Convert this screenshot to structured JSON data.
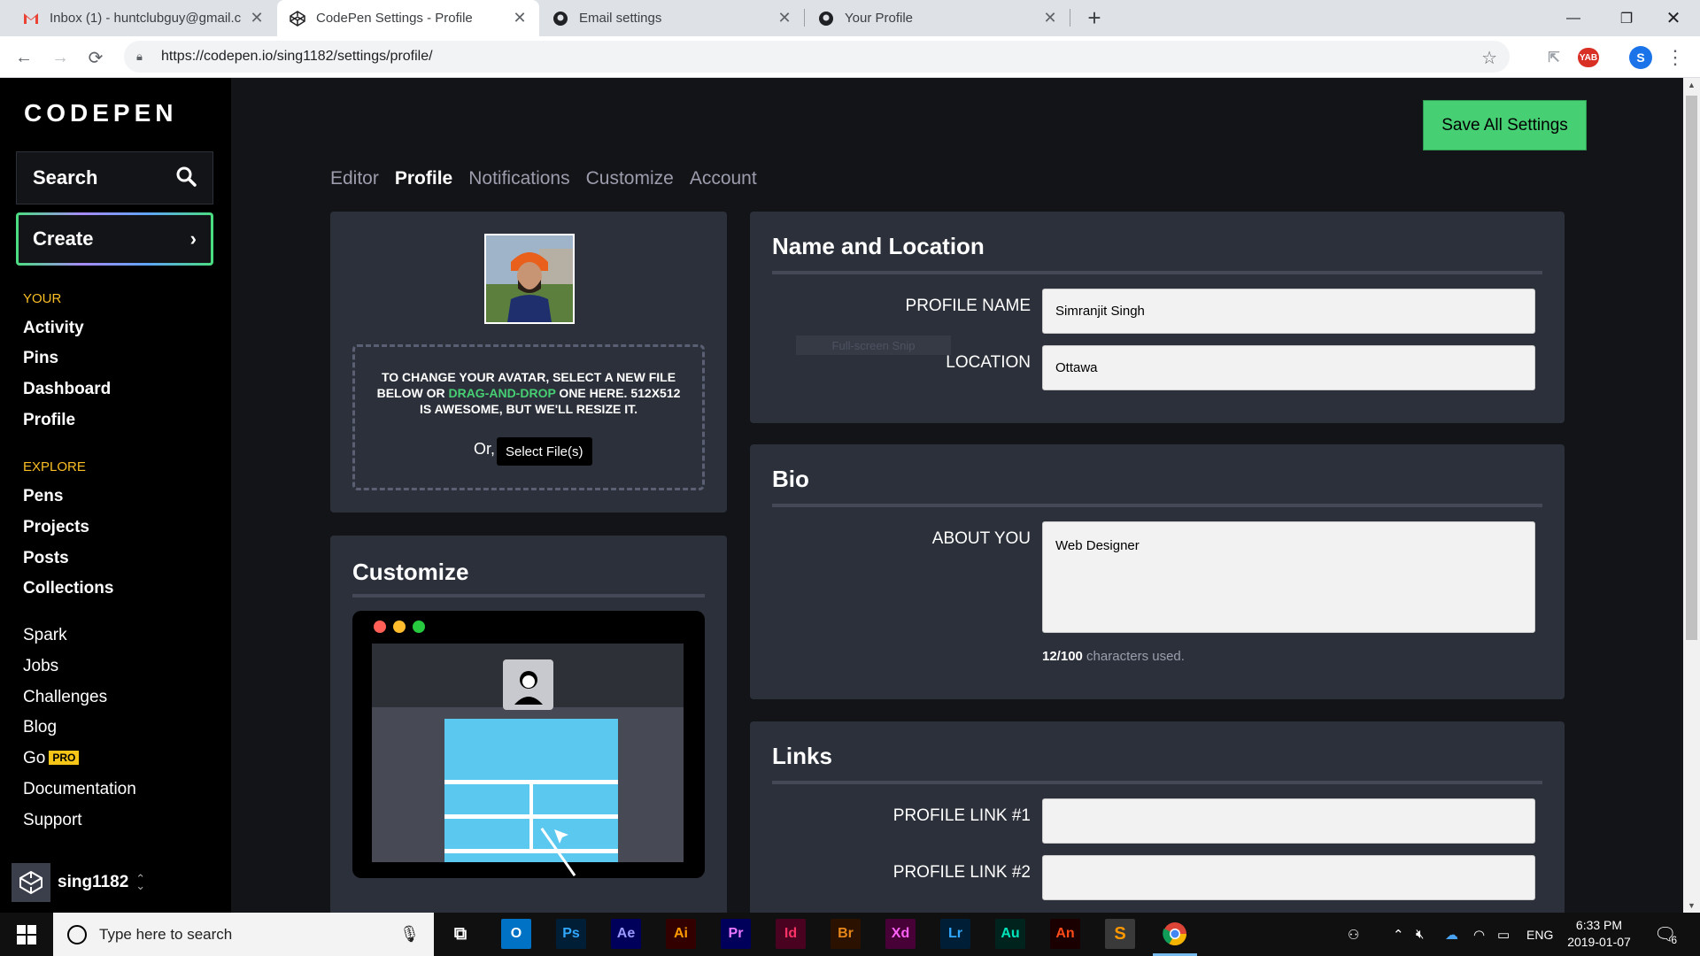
{
  "browser": {
    "tabs": [
      {
        "title": "Inbox (1) - huntclubguy@gmail.c",
        "icon": "gmail-icon"
      },
      {
        "title": "CodePen Settings - Profile",
        "icon": "codepen-icon"
      },
      {
        "title": "Email settings",
        "icon": "github-icon"
      },
      {
        "title": "Your Profile",
        "icon": "github-icon"
      }
    ],
    "url": "https://codepen.io/sing1182/settings/profile/",
    "extension_badge": "YAB",
    "profile_initial": "S"
  },
  "sidebar": {
    "logo": "CODEPEN",
    "search_label": "Search",
    "create_label": "Create",
    "your_label": "YOUR",
    "your_links": [
      "Activity",
      "Pins",
      "Dashboard",
      "Profile"
    ],
    "explore_label": "EXPLORE",
    "explore_links": [
      "Pens",
      "Projects",
      "Posts",
      "Collections"
    ],
    "other_links": [
      "Spark",
      "Jobs",
      "Challenges",
      "Blog",
      "Go",
      "Documentation",
      "Support"
    ],
    "pro_badge": "PRO",
    "username": "sing1182"
  },
  "main": {
    "save_button": "Save All Settings",
    "subnav": [
      "Editor",
      "Profile",
      "Notifications",
      "Customize",
      "Account"
    ],
    "active_tab": "Profile",
    "avatar_card": {
      "instructions_part1": "To change your avatar, select a new file below or ",
      "instructions_highlight": "drag-and-drop",
      "instructions_part2": " one here. 512x512 is awesome, but we'll resize it.",
      "or_label": "Or,",
      "select_button": "Select File(s)"
    },
    "customize_card": {
      "title": "Customize"
    },
    "name_location": {
      "title": "Name and Location",
      "profile_name_label": "PROFILE NAME",
      "profile_name_value": "Simranjit Singh",
      "location_label": "LOCATION",
      "location_value": "Ottawa",
      "snip_ghost": "Full-screen Snip"
    },
    "bio": {
      "title": "Bio",
      "about_label": "ABOUT YOU",
      "about_value": "Web Designer",
      "chars_used": "12/100",
      "chars_suffix": " characters used."
    },
    "links": {
      "title": "Links",
      "link1_label": "PROFILE LINK #1",
      "link1_value": "",
      "link2_label": "PROFILE LINK #2",
      "link2_value": ""
    }
  },
  "taskbar": {
    "search_placeholder": "Type here to search",
    "apps": [
      "Ps",
      "Ae",
      "Ai",
      "Pr",
      "Id",
      "Br",
      "Xd",
      "Lr",
      "Au",
      "An"
    ],
    "language": "ENG",
    "time": "6:33 PM",
    "date": "2019-01-07",
    "notification_count": "6"
  },
  "colors": {
    "codepen_green": "#47cf73",
    "panel_bg": "#2c303a",
    "page_bg": "#131417",
    "section_label": "#fbbf24"
  }
}
